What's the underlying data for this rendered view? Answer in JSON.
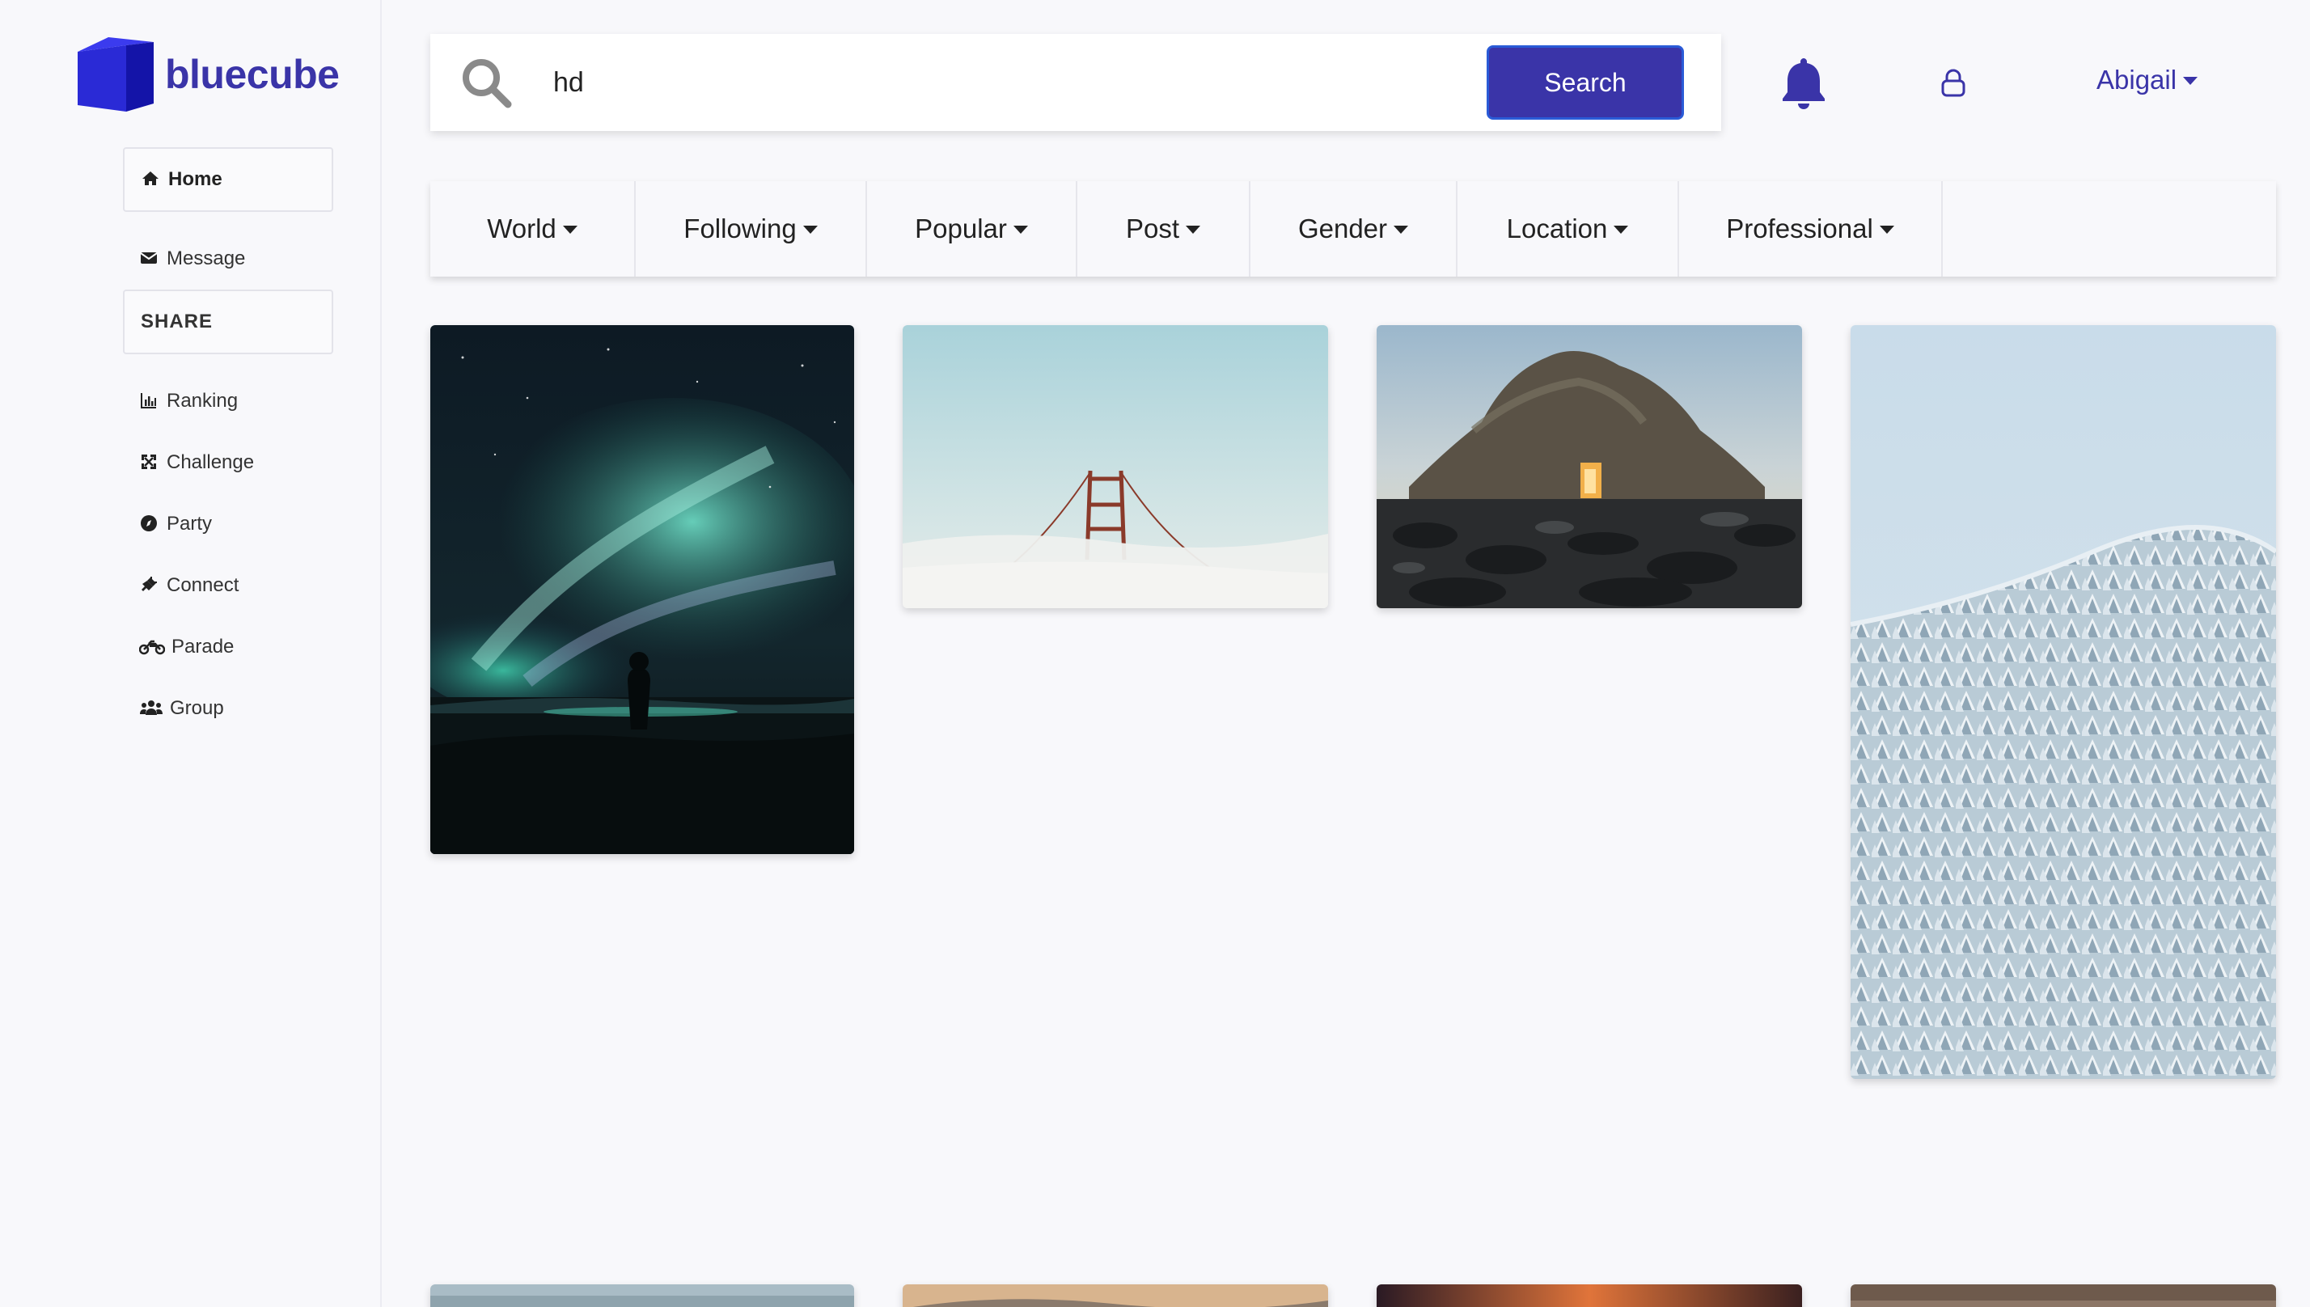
{
  "brand": {
    "name": "bluecube",
    "accent": "#3a34a8"
  },
  "sidebar": {
    "items": [
      {
        "label": "Home",
        "icon": "home-icon"
      },
      {
        "label": "Message",
        "icon": "envelope-icon"
      },
      {
        "label": "SHARE",
        "icon": ""
      },
      {
        "label": "Ranking",
        "icon": "bar-chart-icon"
      },
      {
        "label": "Challenge",
        "icon": "expand-icon"
      },
      {
        "label": "Party",
        "icon": "compass-icon"
      },
      {
        "label": "Connect",
        "icon": "plug-icon"
      },
      {
        "label": "Parade",
        "icon": "motorcycle-icon"
      },
      {
        "label": "Group",
        "icon": "users-icon"
      }
    ]
  },
  "search": {
    "value": "hd",
    "button_label": "Search"
  },
  "header": {
    "user_name": "Abigail"
  },
  "filters": {
    "tabs": [
      {
        "label": "World"
      },
      {
        "label": "Following"
      },
      {
        "label": "Popular"
      },
      {
        "label": "Post"
      },
      {
        "label": "Gender"
      },
      {
        "label": "Location"
      },
      {
        "label": "Professional"
      }
    ]
  },
  "gallery": {
    "photos": [
      {
        "subject": "aurora-night-sky"
      },
      {
        "subject": "bridge-in-fog"
      },
      {
        "subject": "sea-rock-arch"
      },
      {
        "subject": "snowy-forest"
      },
      {
        "subject": "partial-photo"
      },
      {
        "subject": "partial-photo"
      },
      {
        "subject": "partial-photo"
      },
      {
        "subject": "partial-photo"
      }
    ]
  }
}
